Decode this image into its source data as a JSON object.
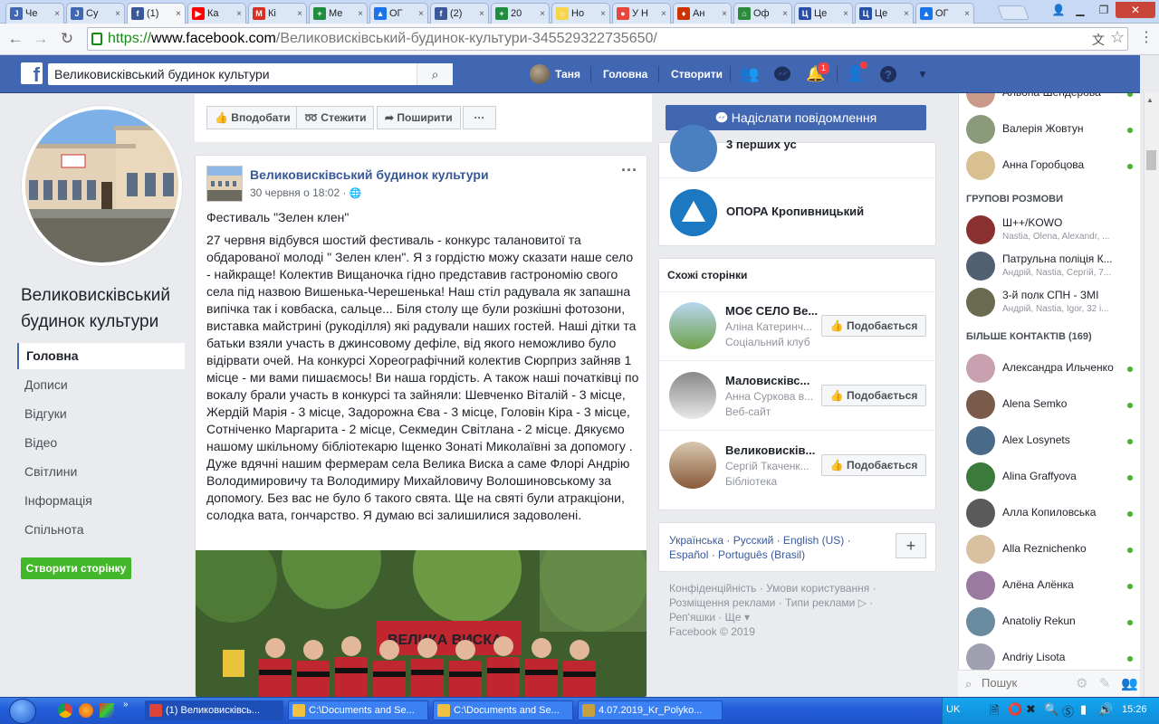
{
  "browser": {
    "tabs": [
      {
        "label": "Че",
        "color": "#4267b2",
        "glyph": "J"
      },
      {
        "label": "Су",
        "color": "#4267b2",
        "glyph": "J"
      },
      {
        "label": "(1)",
        "color": "#3b5998",
        "glyph": "f",
        "active": true
      },
      {
        "label": "Ка",
        "color": "#ff0000",
        "glyph": "▶"
      },
      {
        "label": "Кі",
        "color": "#d93025",
        "glyph": "M"
      },
      {
        "label": "Ме",
        "color": "#1e8e3e",
        "glyph": "+"
      },
      {
        "label": "ОГ",
        "color": "#1a73e8",
        "glyph": "▲"
      },
      {
        "label": "(2)",
        "color": "#3b5998",
        "glyph": "f"
      },
      {
        "label": "20",
        "color": "#1e8e3e",
        "glyph": "+"
      },
      {
        "label": "Но",
        "color": "#f6d54a",
        "glyph": "☼"
      },
      {
        "label": "У Н",
        "color": "#e8453c",
        "glyph": "●"
      },
      {
        "label": "Ан",
        "color": "#cc3300",
        "glyph": "♦"
      },
      {
        "label": "Оф",
        "color": "#2a8c3c",
        "glyph": "⌂"
      },
      {
        "label": "Це",
        "color": "#2850a8",
        "glyph": "Ц"
      },
      {
        "label": "Це",
        "color": "#2850a8",
        "glyph": "Ц"
      },
      {
        "label": "ОГ",
        "color": "#1a73e8",
        "glyph": "▲"
      }
    ],
    "url": {
      "proto": "https://",
      "host": "www.facebook.com",
      "path": "/Великовисківський-будинок-культури-345529322735650/"
    }
  },
  "fb": {
    "search_value": "Великовисківський будинок культури",
    "user_name": "Таня",
    "nav_home": "Головна",
    "nav_create": "Створити",
    "notif_count": "1"
  },
  "page": {
    "name": "Великовисківський будинок культури",
    "nav": [
      "Головна",
      "Дописи",
      "Відгуки",
      "Відео",
      "Світлини",
      "Інформація",
      "Спільнота"
    ],
    "create_page": "Створити сторінку",
    "actions": {
      "like": "Вподобати",
      "follow": "Стежити",
      "share": "Поширити",
      "more": "···"
    },
    "message_button": "Надіслати повідомлення"
  },
  "post": {
    "author": "Великовисківський будинок культури",
    "time": "30 червня о 18:02 ·",
    "title": "Фестиваль \"Зелен клен\"",
    "body": "27 червня відбувся шостий фестиваль - конкурс талановитої та обдарованої молоді \" Зелен клен\". Я з гордістю можу сказати наше село - найкраще! Колектив Вищаночка гідно представив гастрономію свого села під назвою Вишенька-Черешенька! Наш стіл радувала як запашна випічка так і ковбаска, сальце... Біля столу ще були розкішні фотозони, виставка майстрині (рукоділля) які радували наших гостей. Наші дітки та батьки взяли участь в джинсовому дефіле, від якого неможливо було відірвати очей. На конкурсі Хореографічний колектив Сюрприз зайняв 1 місце - ми вами пишаємось! Ви наша гордість. А також наші початківці по вокалу брали участь в конкурсі та зайняли: Шевченко Віталій - 3 місце, Жердій Марія - 3 місце, Задорожна Єва - 3 місце, Головін Кіра - 3 місце, Сотніченко Маргарита - 2 місце, Секмедин Світлана - 2 місце. Дякуємо нашому шкільному бібліотекарю Іщенко Зонаті Миколаївні за допомогу . Дуже вдячні нашим фермерам села Велика Виска а саме Флорі Андрію Володимировичу та Володимиру Михайловичу Волошиновському за допомогу. Без вас не було б такого свята. Ще на святі були атракціони, солодка вата, гончарство. Я думаю всі залишилися задоволені.",
    "photo_banner": "ВЕЛИКА ВИСКА"
  },
  "right": {
    "top_item_partial": "3 перших ус",
    "opora": "ОПОРА Кропивницький",
    "similar_header": "Схожі сторінки",
    "similar": [
      {
        "name": "МОЄ СЕЛО Ве...",
        "sub1": "Аліна Катеринч...",
        "sub2": "Соціальний клуб"
      },
      {
        "name": "Маловисківс...",
        "sub1": "Анна Суркова в...",
        "sub2": "Веб-сайт"
      },
      {
        "name": "Великовисків...",
        "sub1": "Сергій Ткаченк...",
        "sub2": "Бібліотека"
      }
    ],
    "like_label": "Подобається",
    "languages": "Українська · Русский · English (US) · Español · Português (Brasil)",
    "footer": "Конфіденційність · Умови користування · Розміщення реклами · Типи реклами ▷ · Реп'яшки · Ще ▾",
    "copyright": "Facebook © 2019"
  },
  "chat": {
    "top_contacts": [
      "Альона Шендерова",
      "Валерія Жовтун",
      "Анна Горобцова"
    ],
    "group_header": "ГРУПОВІ РОЗМОВИ",
    "groups": [
      {
        "name": "Ш++/KOWO",
        "members": "Nastia, Olena, Alexandr, ..."
      },
      {
        "name": "Патрульна поліція К...",
        "members": "Андрій, Nastia, Сергій, 7..."
      },
      {
        "name": "3-й полк СПН - ЗМІ",
        "members": "Андрій, Nastia, Igor, 32 і..."
      }
    ],
    "more_header": "БІЛЬШЕ КОНТАКТІВ (169)",
    "contacts": [
      "Александра Ильченко",
      "Alena Semko",
      "Alex Losynets",
      "Alina Graffyova",
      "Алла Копиловська",
      "Alla Reznichenko",
      "Алёна Алёнка",
      "Anatoliy Rekun",
      "Andriy Lisota"
    ],
    "search_placeholder": "Пошук"
  },
  "taskbar": {
    "tasks": [
      "(1) Великовисківсь...",
      "C:\\Documents and Se...",
      "C:\\Documents and Se...",
      "4.07.2019_Kr_Polyko..."
    ],
    "lang": "UK",
    "time": "15:26"
  }
}
